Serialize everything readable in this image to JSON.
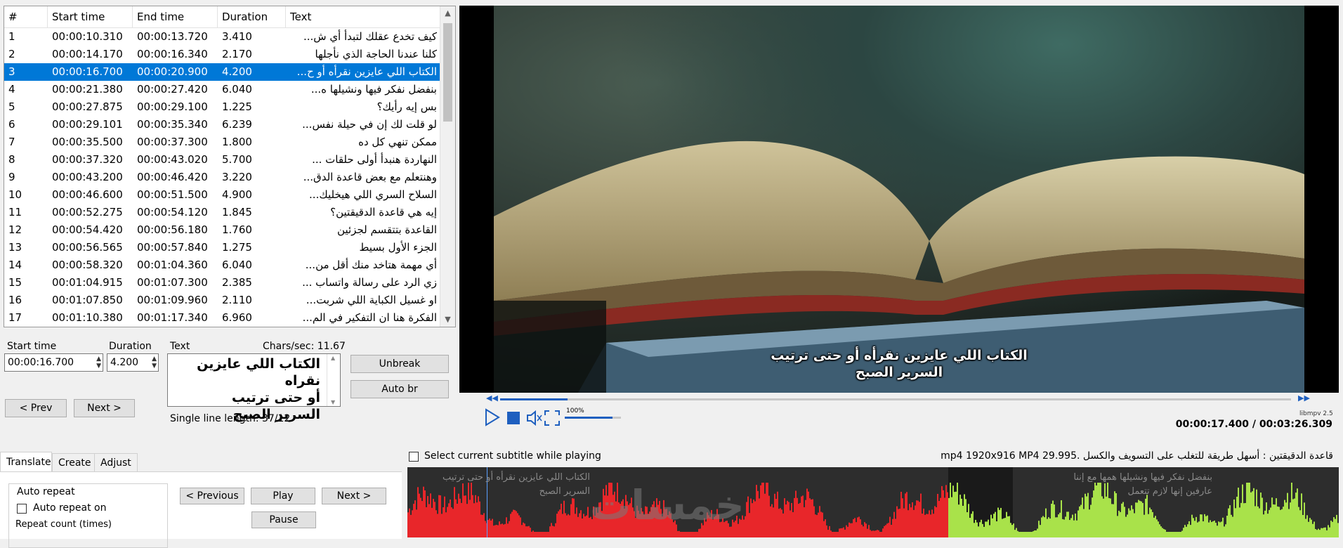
{
  "list": {
    "columns": [
      "#",
      "Start time",
      "End time",
      "Duration",
      "Text"
    ],
    "selected_row": 3,
    "rows": [
      {
        "n": "1",
        "start": "00:00:10.310",
        "end": "00:00:13.720",
        "dur": "3.410",
        "text": "كيف تخدع عقلك لتبدأ أي ش..."
      },
      {
        "n": "2",
        "start": "00:00:14.170",
        "end": "00:00:16.340",
        "dur": "2.170",
        "text": "كلنا عندنا الحاجة الذي نأجلها"
      },
      {
        "n": "3",
        "start": "00:00:16.700",
        "end": "00:00:20.900",
        "dur": "4.200",
        "text": "الكتاب اللي عايزين نقرأه أو ح..."
      },
      {
        "n": "4",
        "start": "00:00:21.380",
        "end": "00:00:27.420",
        "dur": "6.040",
        "text": "بنفضل نفكر فيها ونشيلها ه..."
      },
      {
        "n": "5",
        "start": "00:00:27.875",
        "end": "00:00:29.100",
        "dur": "1.225",
        "text": "بس إيه رأيك؟"
      },
      {
        "n": "6",
        "start": "00:00:29.101",
        "end": "00:00:35.340",
        "dur": "6.239",
        "text": "لو قلت لك إن في حيلة نفس..."
      },
      {
        "n": "7",
        "start": "00:00:35.500",
        "end": "00:00:37.300",
        "dur": "1.800",
        "text": "ممكن تنهي كل ده"
      },
      {
        "n": "8",
        "start": "00:00:37.320",
        "end": "00:00:43.020",
        "dur": "5.700",
        "text": "النهاردة هنبدأ أولى حلقات ..."
      },
      {
        "n": "9",
        "start": "00:00:43.200",
        "end": "00:00:46.420",
        "dur": "3.220",
        "text": "وهنتعلم مع بعض قاعدة الدق..."
      },
      {
        "n": "10",
        "start": "00:00:46.600",
        "end": "00:00:51.500",
        "dur": "4.900",
        "text": "السلاح السري اللي هيخليك..."
      },
      {
        "n": "11",
        "start": "00:00:52.275",
        "end": "00:00:54.120",
        "dur": "1.845",
        "text": "إيه هي قاعدة الدقيقتين؟"
      },
      {
        "n": "12",
        "start": "00:00:54.420",
        "end": "00:00:56.180",
        "dur": "1.760",
        "text": "القاعدة بتتقسم لجزئين"
      },
      {
        "n": "13",
        "start": "00:00:56.565",
        "end": "00:00:57.840",
        "dur": "1.275",
        "text": "الجزء الأول بسيط"
      },
      {
        "n": "14",
        "start": "00:00:58.320",
        "end": "00:01:04.360",
        "dur": "6.040",
        "text": "أي مهمة هتاخد منك أقل من..."
      },
      {
        "n": "15",
        "start": "00:01:04.915",
        "end": "00:01:07.300",
        "dur": "2.385",
        "text": "زي الرد على رسالة واتساب ..."
      },
      {
        "n": "16",
        "start": "00:01:07.850",
        "end": "00:01:09.960",
        "dur": "2.110",
        "text": "او غسيل الكباية اللي شربت..."
      },
      {
        "n": "17",
        "start": "00:01:10.380",
        "end": "00:01:17.340",
        "dur": "6.960",
        "text": "الفكرة هنا ان التفكير في الم..."
      }
    ]
  },
  "editor": {
    "start_label": "Start time",
    "duration_label": "Duration",
    "text_label": "Text",
    "chars_sec": "Chars/sec: 11.67",
    "start_value": "00:00:16.700",
    "duration_value": "4.200",
    "text_value": "الكتاب اللي عايزين نقراه\nأو حتى ترتيب\nالسرير الصبح",
    "unbreak": "Unbreak",
    "auto_br": "Auto br",
    "prev": "< Prev",
    "next": "Next >",
    "single_line": "Single line length: 37/12"
  },
  "video": {
    "subtitle": "الكتاب اللي عايزين نقرأه أو حتى ترتيب\nالسرير الصبح",
    "volume_label": "100%",
    "volume_fraction": 0.85,
    "progress_fraction": 0.085,
    "engine": "libmpv 2.5",
    "time": "00:00:17.400 / 00:03:26.309"
  },
  "bottom": {
    "tabs": [
      "Translate",
      "Create",
      "Adjust"
    ],
    "active_tab": "Translate",
    "select_current_label": "Select current subtitle while playing",
    "file_info": "قاعدة الدقيقتين : أسهل طريقة للتغلب على التسويف والكسل .mp4 1920x916 MP4 29.995",
    "auto_repeat_group": "Auto repeat",
    "auto_repeat_on": "Auto repeat on",
    "repeat_count": "Repeat count (times)",
    "previous": "< Previous",
    "play": "Play",
    "next": "Next >",
    "pause": "Pause"
  },
  "waveform": {
    "text_left": "الكتاب اللي عايزين نقرأه أو حتى ترتيب\nالسرير الصبح",
    "text_right": "بنفضل نفكر فيها ونشيلها همها مع إننا\nعارفين إنها لازم تتعمل",
    "watermark": "خمسات",
    "colors": {
      "played": "#e8262a",
      "unplayed": "#a9e24a"
    }
  },
  "colors": {
    "selection": "#0078d7",
    "accent": "#1e5fbf"
  }
}
